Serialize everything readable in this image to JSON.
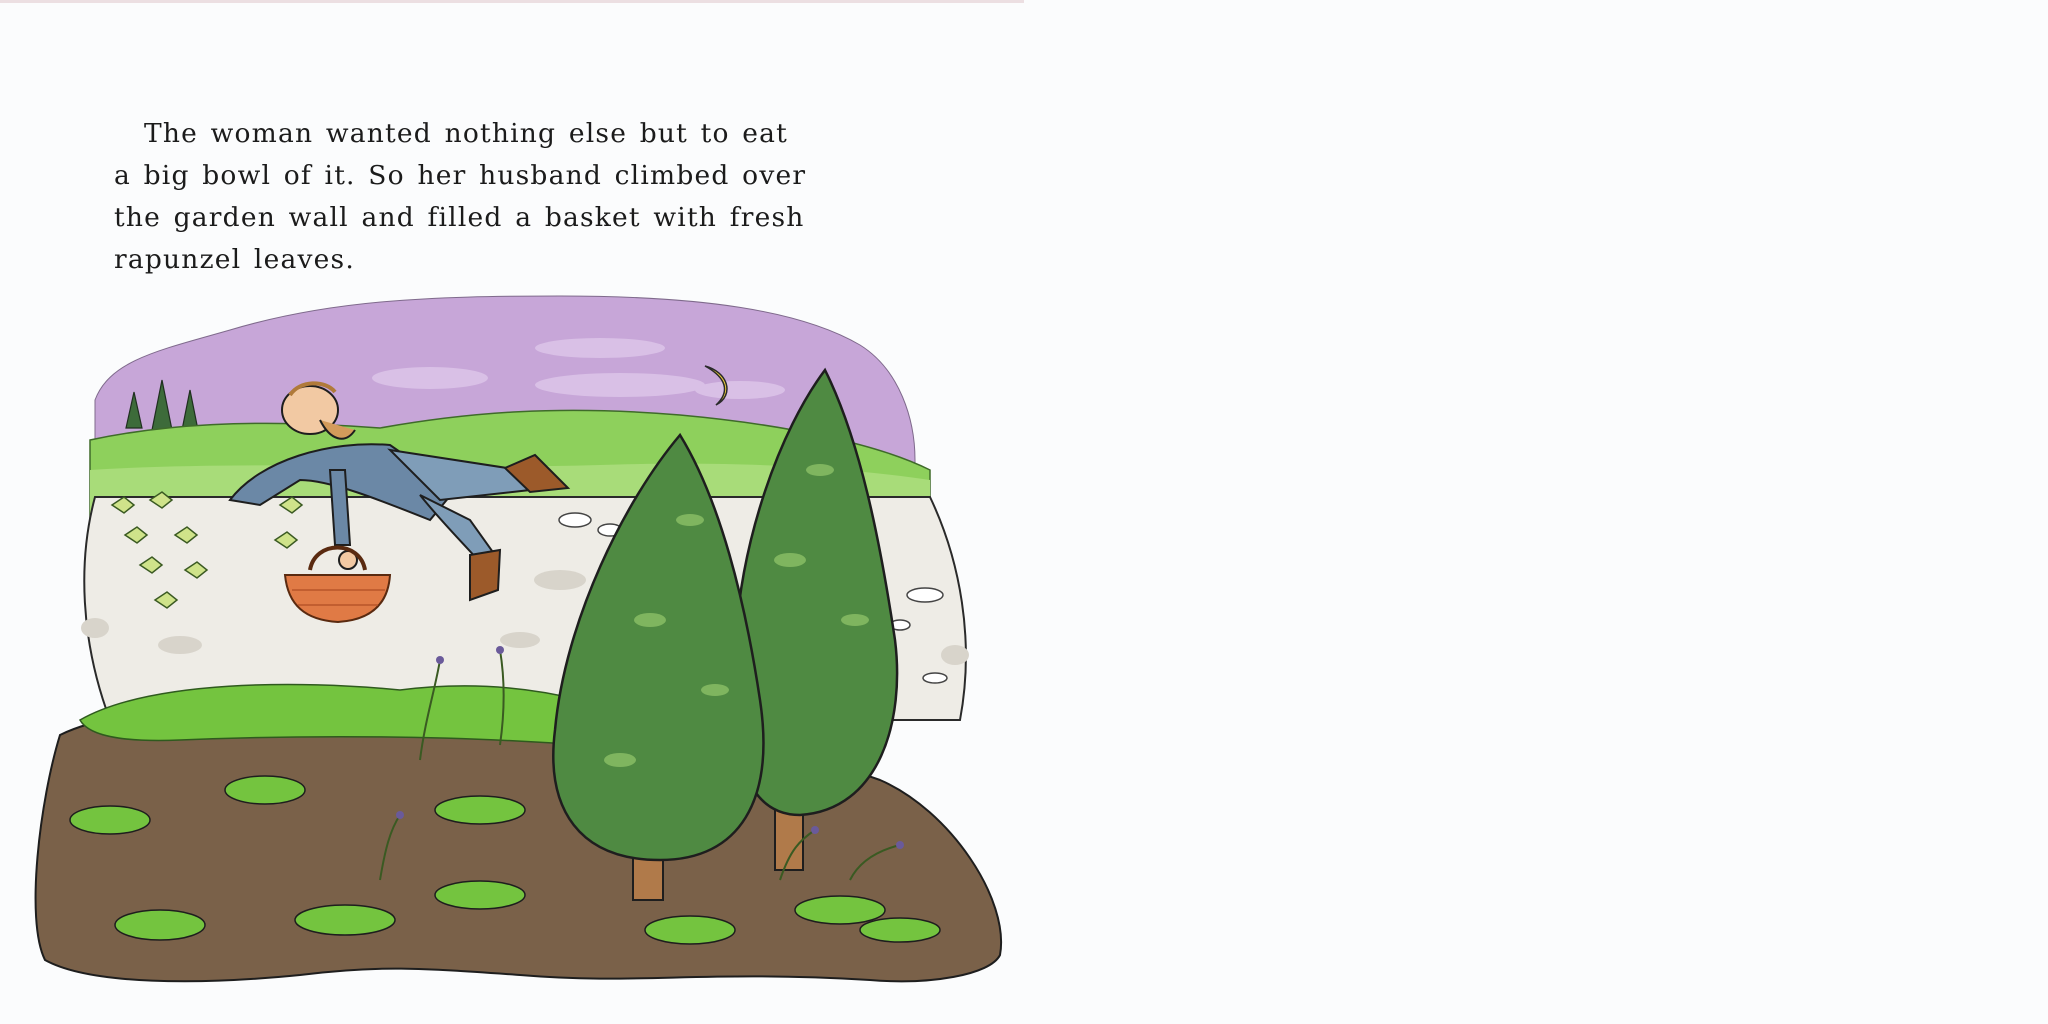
{
  "story": {
    "lines": [
      "The woman wanted nothing else but to eat",
      "a big bowl of it. So her husband climbed over",
      "the garden wall and filled a basket with fresh",
      "rapunzel leaves."
    ]
  },
  "illustration": {
    "colors": {
      "sky": "#c7a6d8",
      "cloud": "#d9c0e6",
      "hill": "#8ed05c",
      "wall": "#eeece6",
      "soil": "#7a6149",
      "tree": "#4f8a42",
      "plant": "#74c43f",
      "basket": "#e07a45",
      "moon": "#f4d23c",
      "jacket": "#6b88a6",
      "boots": "#9c5a2a"
    },
    "elements": [
      "night-sky",
      "crescent-moon",
      "green-hills",
      "garden-wall",
      "man-climbing-wall",
      "basket",
      "cypress-trees",
      "rapunzel-plants",
      "garden-soil"
    ]
  }
}
